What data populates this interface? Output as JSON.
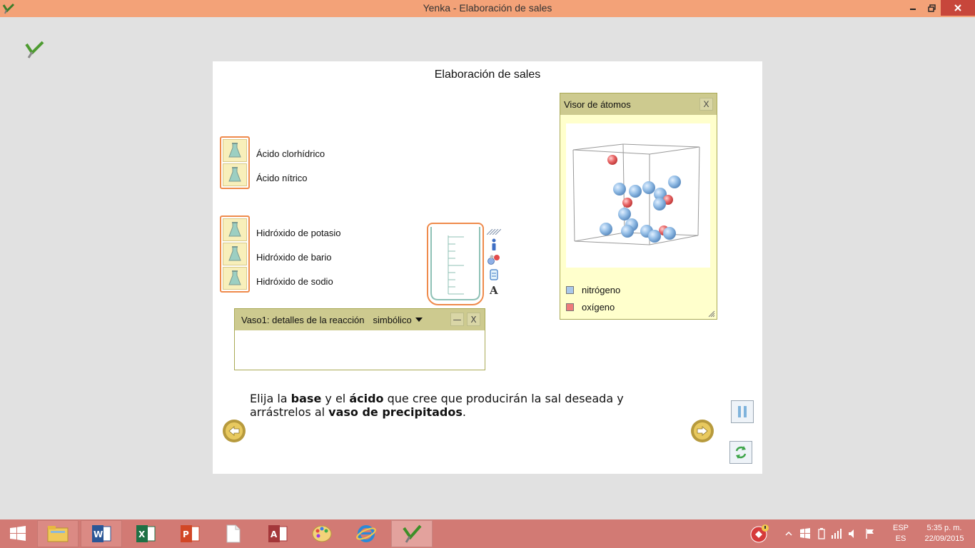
{
  "window": {
    "title": "Yenka - Elaboración de sales"
  },
  "stage": {
    "title": "Elaboración de sales",
    "acids": [
      {
        "label": "Ácido clorhídrico"
      },
      {
        "label": "Ácido nítrico"
      }
    ],
    "bases": [
      {
        "label": "Hidróxido de potasio"
      },
      {
        "label": "Hidróxido de bario"
      },
      {
        "label": "Hidróxido de sodio"
      }
    ],
    "beaker_tools": [
      "info-icon",
      "atoms-icon",
      "beaker-small-icon",
      "text-icon"
    ],
    "reaction_panel": {
      "title": "Vaso1: detalles de la reacción",
      "mode": "simbólico",
      "minimize_label": "—",
      "close_label": "X"
    },
    "atom_viewer": {
      "title": "Visor de átomos",
      "close_label": "X",
      "legend": [
        {
          "label": "nitrógeno",
          "color": "#a9c8ea"
        },
        {
          "label": "oxígeno",
          "color": "#ee7b7b"
        }
      ]
    },
    "instruction": {
      "p1": "Elija la ",
      "b1": "base",
      "p2": " y el ",
      "b2": "ácido",
      "p3": " que cree que producirán la sal deseada y arrástrelos al ",
      "b3": "vaso de precipitados",
      "p4": "."
    }
  },
  "taskbar": {
    "apps": [
      "windows-start",
      "file-explorer",
      "word",
      "excel",
      "powerpoint",
      "document",
      "access",
      "paint",
      "internet-explorer",
      "yenka"
    ],
    "tray": {
      "lang_top": "ESP",
      "lang_bottom": "ES",
      "time": "5:35 p. m.",
      "date": "22/09/2015"
    }
  },
  "colors": {
    "accent_orange": "#ef8a4b",
    "panel_header": "#cdca8f",
    "titlebar": "#f3a278",
    "taskbar": "#d27a74"
  }
}
